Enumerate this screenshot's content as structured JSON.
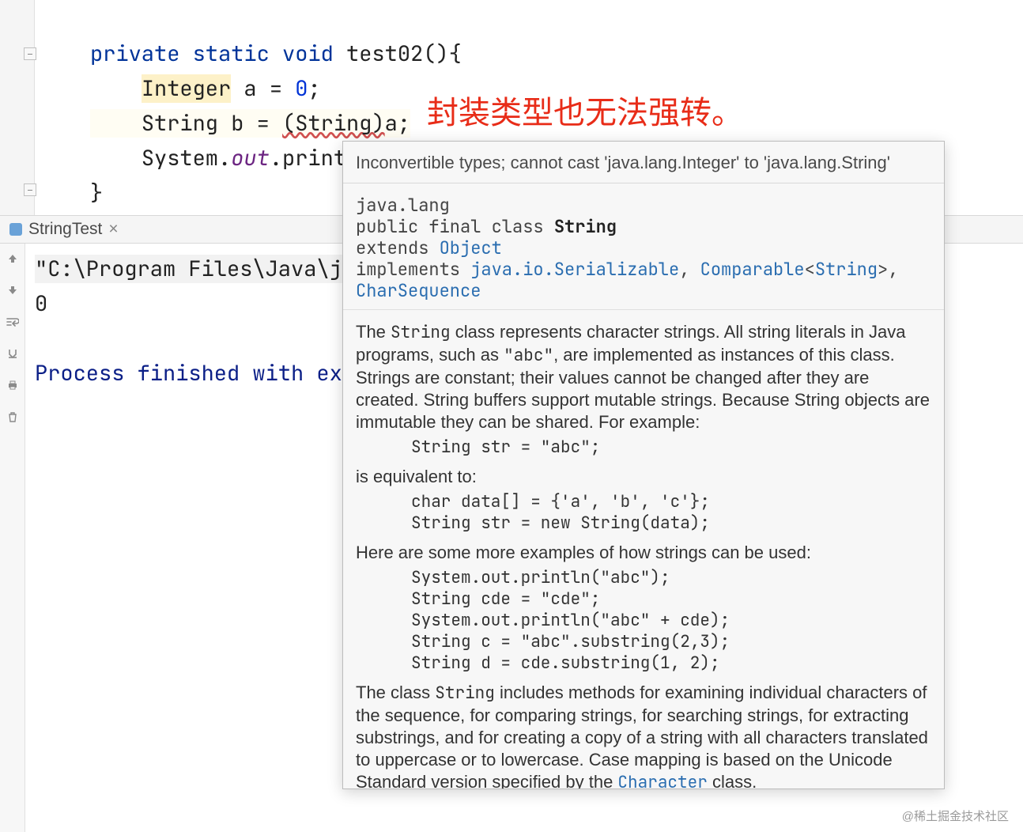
{
  "annotation": "封装类型也无法强转。",
  "code": {
    "kw_private": "private",
    "kw_static": "static",
    "kw_void": "void",
    "method_name": "test02",
    "int_type": "Integer",
    "var_a": "a",
    "eq": "=",
    "zero": "0",
    "semi": ";",
    "string_type": "String",
    "var_b": "b",
    "cast_open": "(String)",
    "sys_out": "System",
    "dot": ".",
    "out": "out",
    "print": "print"
  },
  "tab": {
    "name": "StringTest",
    "close": "×"
  },
  "console": {
    "path": "\"C:\\Program Files\\Java\\j",
    "zero": "0",
    "exit": "Process finished with ex"
  },
  "popup": {
    "error": "Inconvertible types; cannot cast 'java.lang.Integer' to 'java.lang.String'",
    "sig": {
      "pkg": "java.lang",
      "mods": "public final class ",
      "name": "String",
      "ext": "extends ",
      "obj": "Object",
      "impl": "implements ",
      "ser": "java.io.Serializable",
      "comma1": ", ",
      "comp": "Comparable",
      "lt": "<",
      "stringLink": "String",
      "gt": ">",
      "comma2": ", ",
      "cs": "CharSequence"
    },
    "para1a": "The ",
    "para1_code": "String",
    "para1b": " class represents character strings. All string literals in Java programs, such as ",
    "para1_code2": "\"abc\"",
    "para1c": ", are implemented as instances of this class.",
    "para2": "Strings are constant; their values cannot be changed after they are created. String buffers support mutable strings. Because String objects are immutable they can be shared. For example:",
    "ex1": "String str = \"abc\";",
    "para3": "is equivalent to:",
    "ex2": "char data[] = {'a', 'b', 'c'};\nString str = new String(data);",
    "para4": "Here are some more examples of how strings can be used:",
    "ex3": "System.out.println(\"abc\");\nString cde = \"cde\";\nSystem.out.println(\"abc\" + cde);\nString c = \"abc\".substring(2,3);\nString d = cde.substring(1, 2);",
    "para5a": "The class ",
    "para5_code": "String",
    "para5b": " includes methods for examining individual characters of the sequence, for comparing strings, for searching strings, for extracting substrings, and for creating a copy of a string with all characters translated to uppercase or to lowercase. Case mapping is based on the Unicode Standard version specified by the ",
    "para5_link": "Character",
    "para5c": " class."
  },
  "watermark": "@稀土掘金技术社区",
  "gutter_icons": [
    "arrow-up",
    "arrow-down",
    "wrap",
    "download",
    "print",
    "trash"
  ]
}
